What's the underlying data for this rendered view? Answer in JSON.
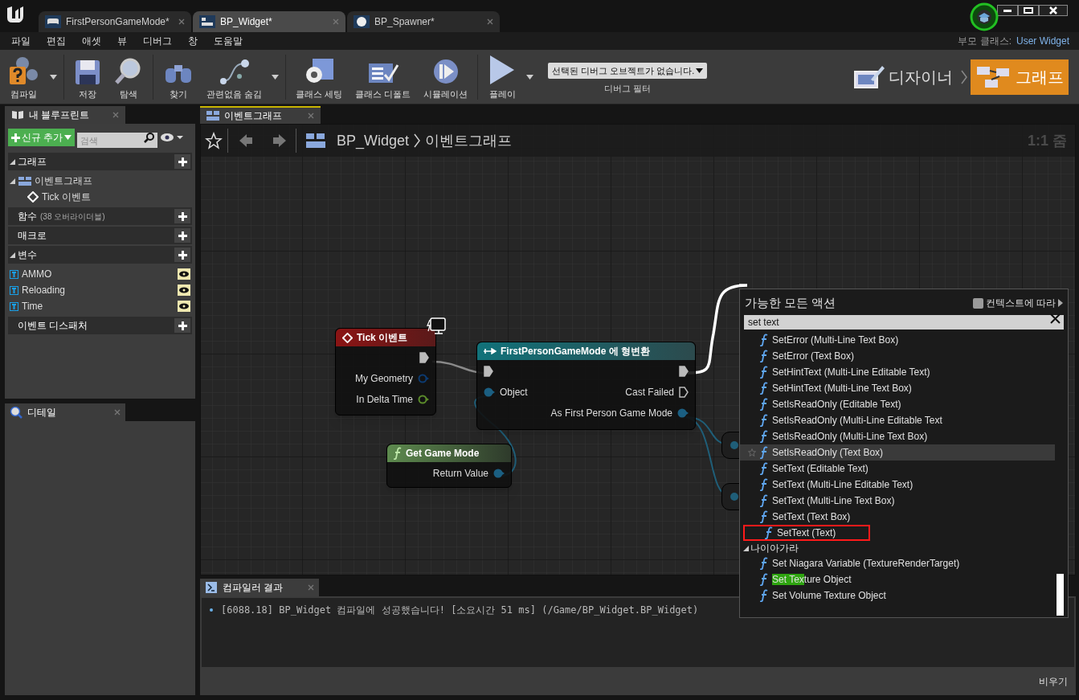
{
  "doc_tabs": [
    {
      "label": "FirstPersonGameMode*",
      "kind": "gamemode",
      "selected": false
    },
    {
      "label": "BP_Widget*",
      "kind": "widget",
      "selected": true
    },
    {
      "label": "BP_Spawner*",
      "kind": "sphere",
      "selected": false
    }
  ],
  "menu": [
    "파일",
    "편집",
    "애셋",
    "뷰",
    "디버그",
    "창",
    "도움말"
  ],
  "parent_class": {
    "label": "부모 클래스:",
    "value": "User Widget"
  },
  "toolbar": [
    {
      "label": "컴파일",
      "kind": "compile",
      "dropdown": true
    },
    {
      "label": "저장",
      "kind": "save",
      "dropdown": false
    },
    {
      "label": "탐색",
      "kind": "browse",
      "dropdown": false
    },
    {
      "label": "찾기",
      "kind": "find",
      "dropdown": false
    },
    {
      "label": "관련없음 숨김",
      "kind": "hide",
      "dropdown": true
    },
    {
      "label": "클래스 세팅",
      "kind": "settings",
      "dropdown": false
    },
    {
      "label": "클래스 디폴트",
      "kind": "defaults",
      "dropdown": false
    },
    {
      "label": "시뮬레이션",
      "kind": "simulate",
      "dropdown": false
    },
    {
      "label": "플레이",
      "kind": "play",
      "dropdown": true
    }
  ],
  "debug_filter": {
    "value": "선택된 디버그 오브젝트가 없습니다.",
    "label": "디버그 필터"
  },
  "modes": [
    {
      "label": "디자이너",
      "kind": "designer",
      "selected": false
    },
    {
      "label": "그래프",
      "kind": "graph",
      "selected": true
    }
  ],
  "my_blueprint": {
    "tab": "내 블루프린트",
    "add_button": "신규 추가",
    "search_placeholder": "검색",
    "sections": [
      {
        "title": "그래프",
        "expanded": true,
        "items": [
          {
            "label": "이벤트그래프",
            "kind": "graph",
            "expanded": true,
            "children": [
              {
                "label": "Tick 이벤트",
                "kind": "event"
              }
            ]
          }
        ]
      },
      {
        "title": "함수",
        "note": "(38 오버라이더블)",
        "expanded": false
      },
      {
        "title": "매크로",
        "expanded": false
      },
      {
        "title": "변수",
        "expanded": true,
        "items": [
          {
            "label": "AMMO",
            "kind": "variable"
          },
          {
            "label": "Reloading",
            "kind": "variable"
          },
          {
            "label": "Time",
            "kind": "variable"
          }
        ]
      },
      {
        "title": "이벤트 디스패처",
        "expanded": false
      }
    ]
  },
  "details": {
    "tab": "디테일"
  },
  "graph": {
    "tab": "이벤트그래프",
    "breadcrumb": [
      "BP_Widget",
      "이벤트그래프"
    ],
    "zoom": "1:1 줌",
    "nodes": [
      {
        "title": "Tick 이벤트",
        "kind": "event",
        "outputs": [
          {
            "kind": "exec",
            "connected": true
          },
          {
            "label": "My Geometry",
            "kind": "struct",
            "connected": false
          },
          {
            "label": "In Delta Time",
            "kind": "float",
            "connected": false
          }
        ]
      },
      {
        "title": "FirstPersonGameMode 에 형변환",
        "kind": "cast",
        "inputs": [
          {
            "kind": "exec",
            "connected": true
          },
          {
            "label": "Object",
            "kind": "object",
            "connected": true
          }
        ],
        "outputs": [
          {
            "kind": "exec",
            "connected": true
          },
          {
            "label": "Cast Failed",
            "kind": "exec",
            "connected": false
          },
          {
            "label": "As First Person Game Mode",
            "kind": "object",
            "connected": true
          }
        ]
      },
      {
        "title": "Get Game Mode",
        "kind": "function",
        "outputs": [
          {
            "label": "Return Value",
            "kind": "object",
            "connected": true
          }
        ]
      }
    ]
  },
  "action_menu": {
    "title": "가능한 모든 액션",
    "context_label": "컨텍스트에 따라",
    "context_checked": false,
    "search": "set text",
    "items": [
      {
        "label": "SetError (Multi-Line Text Box)",
        "hovered": false,
        "outlined": false
      },
      {
        "label": "SetError (Text Box)",
        "hovered": false,
        "outlined": false
      },
      {
        "label": "SetHintText (Multi-Line Editable Text)",
        "hovered": false,
        "outlined": false
      },
      {
        "label": "SetHintText (Multi-Line Text Box)",
        "hovered": false,
        "outlined": false
      },
      {
        "label": "SetIsReadOnly (Editable Text)",
        "hovered": false,
        "outlined": false
      },
      {
        "label": "SetIsReadOnly (Multi-Line Editable Text",
        "hovered": false,
        "outlined": false
      },
      {
        "label": "SetIsReadOnly (Multi-Line Text Box)",
        "hovered": false,
        "outlined": false
      },
      {
        "label": "SetIsReadOnly (Text Box)",
        "hovered": true,
        "outlined": false
      },
      {
        "label": "SetText (Editable Text)",
        "hovered": false,
        "outlined": false
      },
      {
        "label": "SetText (Multi-Line Editable Text)",
        "hovered": false,
        "outlined": false
      },
      {
        "label": "SetText (Multi-Line Text Box)",
        "hovered": false,
        "outlined": false
      },
      {
        "label": "SetText (Text Box)",
        "hovered": false,
        "outlined": false
      },
      {
        "label": "SetText (Text)",
        "hovered": false,
        "outlined": true
      }
    ],
    "categories": [
      {
        "title": "나이아가라",
        "expanded": true,
        "items": [
          {
            "parts": [
              {
                "text": "Set Niagara Variable (TextureRenderTarget)",
                "highlighted": false
              }
            ]
          },
          {
            "parts": [
              {
                "text": "Set Tex",
                "highlighted": true
              },
              {
                "text": "ture Object",
                "highlighted": false
              }
            ]
          },
          {
            "parts": [
              {
                "text": "Set Volume Texture Object",
                "highlighted": false
              }
            ]
          }
        ]
      }
    ]
  },
  "compiler": {
    "tab": "컴파일러 결과",
    "messages": [
      "[6088.18] BP_Widget 컴파일에 성공했습니다! [소요시간 51 ms] (/Game/BP_Widget.BP_Widget)"
    ],
    "clear_button": "비우기"
  }
}
